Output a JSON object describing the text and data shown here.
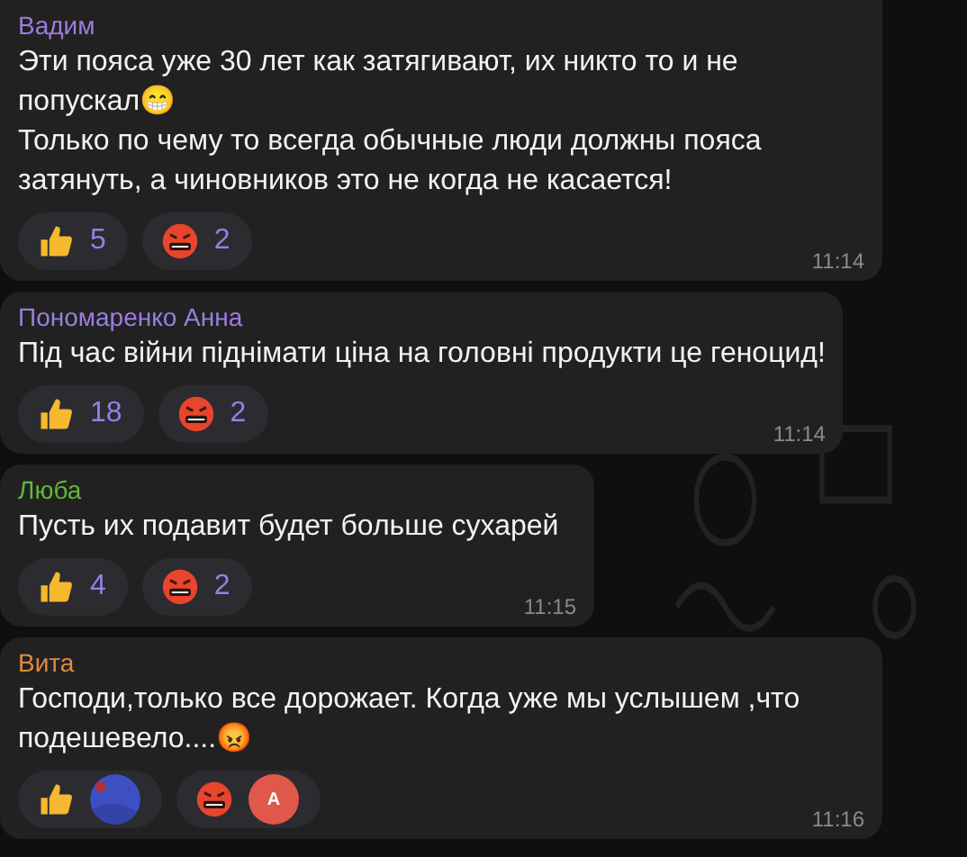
{
  "messages": [
    {
      "author": "Вадим",
      "color": "#9b7de0",
      "lines": [
        "Эти пояса уже 30 лет как затягивают, их никто то и не попускал😁",
        "Только по чему то всегда обычные люди должны пояса затянуть, а чиновников это не когда не касается!"
      ],
      "reactions": [
        {
          "kind": "thumbs_up",
          "count": "5"
        },
        {
          "kind": "angry",
          "count": "2"
        }
      ],
      "time": "11:14"
    },
    {
      "author": "Пономаренко Анна",
      "color": "#9b7de0",
      "lines": [
        "Під час війни піднімати ціна на головні продукти це геноцид!"
      ],
      "reactions": [
        {
          "kind": "thumbs_up",
          "count": "18"
        },
        {
          "kind": "angry",
          "count": "2"
        }
      ],
      "time": "11:14"
    },
    {
      "author": "Люба",
      "color": "#5fb83c",
      "lines": [
        "Пусть их подавит будет больше сухарей"
      ],
      "reactions": [
        {
          "kind": "thumbs_up",
          "count": "4"
        },
        {
          "kind": "angry",
          "count": "2"
        }
      ],
      "time": "11:15"
    },
    {
      "author": "Вита",
      "color": "#e08a3c",
      "lines": [
        "Господи,только все дорожает. Когда уже мы услышем ,что подешевело....😡"
      ],
      "reactions": [
        {
          "kind": "thumbs_up"
        },
        {
          "kind": "angry",
          "avatar": {
            "kind": "letter",
            "letter": "A",
            "color": "#e0584a"
          }
        }
      ],
      "time": "11:16"
    }
  ]
}
